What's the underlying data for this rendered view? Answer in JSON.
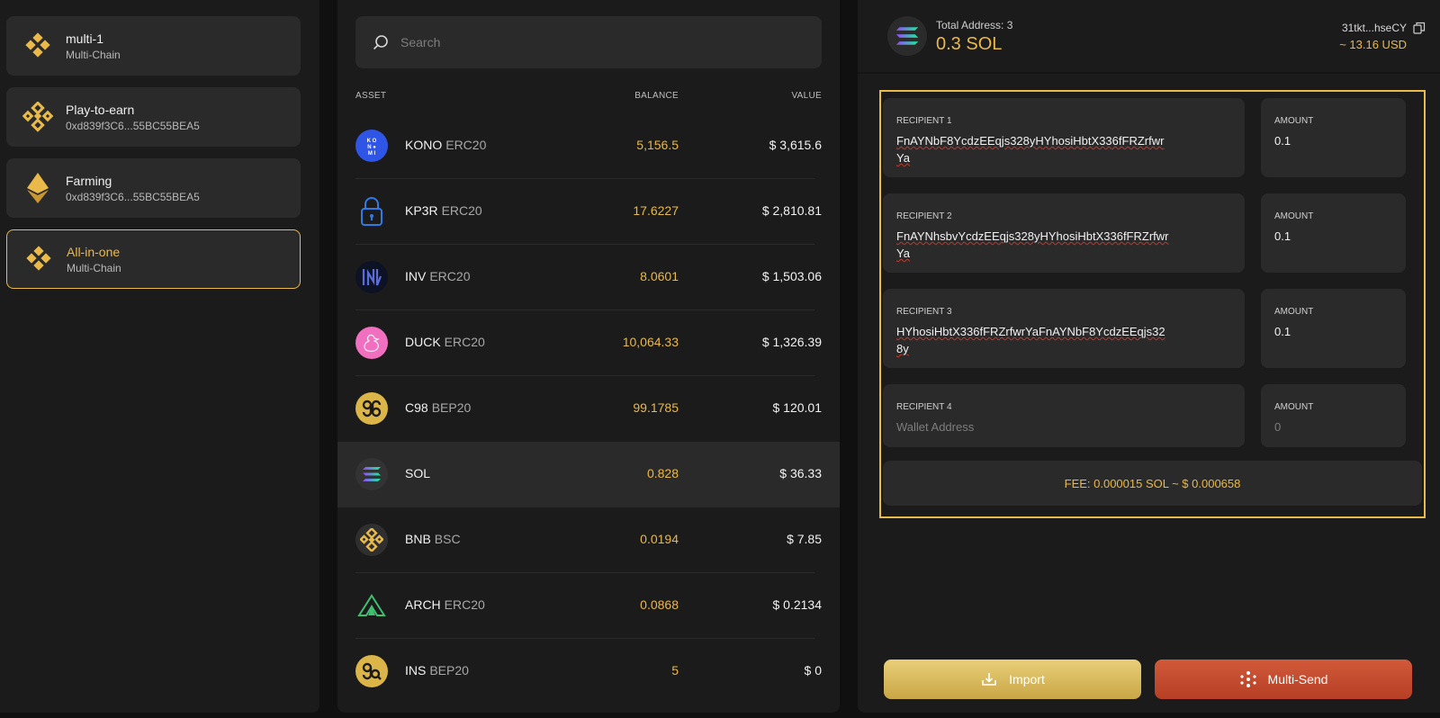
{
  "wallets": [
    {
      "name": "multi-1",
      "sub": "Multi-Chain",
      "icon": "bnb-icon",
      "active": false
    },
    {
      "name": "Play-to-earn",
      "sub": "0xd839f3C6...55BC55BEA5",
      "icon": "bnb-icon",
      "active": false
    },
    {
      "name": "Farming",
      "sub": "0xd839f3C6...55BC55BEA5",
      "icon": "eth-icon",
      "active": false
    },
    {
      "name": "All-in-one",
      "sub": "Multi-Chain",
      "icon": "bnb-icon",
      "active": true
    }
  ],
  "search": {
    "placeholder": "Search"
  },
  "table": {
    "headers": {
      "asset": "ASSET",
      "balance": "BALANCE",
      "value": "VALUE"
    },
    "rows": [
      {
        "symbol": "KONO",
        "network": "ERC20",
        "balance": "5,156.5",
        "value": "$ 3,615.6",
        "icon": "kono-icon"
      },
      {
        "symbol": "KP3R",
        "network": "ERC20",
        "balance": "17.6227",
        "value": "$ 2,810.81",
        "icon": "lock-icon"
      },
      {
        "symbol": "INV",
        "network": "ERC20",
        "balance": "8.0601",
        "value": "$ 1,503.06",
        "icon": "inv-icon"
      },
      {
        "symbol": "DUCK",
        "network": "ERC20",
        "balance": "10,064.33",
        "value": "$ 1,326.39",
        "icon": "duck-icon"
      },
      {
        "symbol": "C98",
        "network": "BEP20",
        "balance": "99.1785",
        "value": "$ 120.01",
        "icon": "c98-icon"
      },
      {
        "symbol": "SOL",
        "network": "",
        "balance": "0.828",
        "value": "$ 36.33",
        "icon": "sol-icon"
      },
      {
        "symbol": "BNB",
        "network": "BSC",
        "balance": "0.0194",
        "value": "$ 7.85",
        "icon": "bnb-icon"
      },
      {
        "symbol": "ARCH",
        "network": "ERC20",
        "balance": "0.0868",
        "value": "$ 0.2134",
        "icon": "arch-icon"
      },
      {
        "symbol": "INS",
        "network": "BEP20",
        "balance": "5",
        "value": "$ 0",
        "icon": "ins-icon"
      }
    ]
  },
  "send": {
    "total_label": "Total Address: 3",
    "total_amount": "0.3 SOL",
    "address_short": "31tkt...hseCY",
    "usd_value": "~ 13.16 USD",
    "recipients": [
      {
        "label": "RECIPIENT 1",
        "address": "FnAYNbF8YcdzEEqjs328yHYhosiHbtX336fFRZrfwrYa",
        "amount_label": "AMOUNT",
        "amount": "0.1"
      },
      {
        "label": "RECIPIENT 2",
        "address": "FnAYNhsbvYcdzEEqjs328yHYhosiHbtX336fFRZrfwrYa",
        "amount_label": "AMOUNT",
        "amount": "0.1"
      },
      {
        "label": "RECIPIENT 3",
        "address": "HYhosiHbtX336fFRZrfwrYaFnAYNbF8YcdzEEqjs328y",
        "amount_label": "AMOUNT",
        "amount": "0.1"
      },
      {
        "label": "RECIPIENT 4",
        "address_placeholder": "Wallet Address",
        "amount_label": "AMOUNT",
        "amount_placeholder": "0"
      }
    ],
    "fee": "FEE: 0.000015 SOL ~ $ 0.000658",
    "import_label": "Import",
    "multisend_label": "Multi-Send"
  },
  "colors": {
    "accent": "#e9b949",
    "send_button": "#c84a2e",
    "panel": "#1b1b1b",
    "card": "#2a2a2a"
  }
}
